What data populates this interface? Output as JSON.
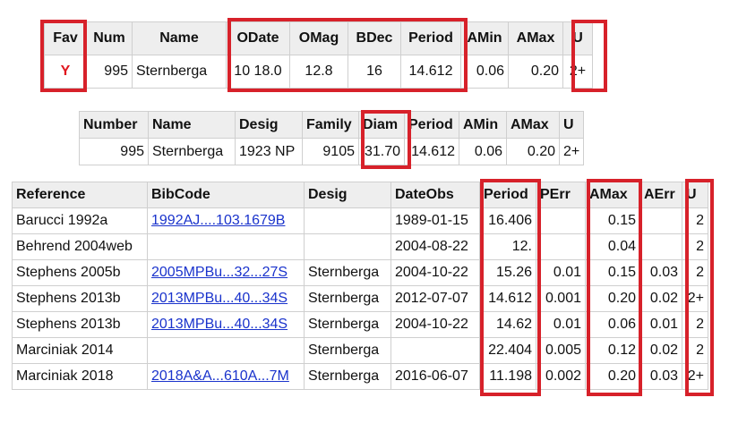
{
  "summary": {
    "headers": [
      "Fav",
      "Num",
      "Name",
      "ODate",
      "OMag",
      "BDec",
      "Period",
      "AMin",
      "AMax",
      "U"
    ],
    "row": {
      "fav": "Y",
      "num": "995",
      "name": "Sternberga",
      "odate": "10 18.0",
      "omag": "12.8",
      "bdec": "16",
      "period": "14.612",
      "amin": "0.06",
      "amax": "0.20",
      "u": "2+"
    }
  },
  "physical": {
    "headers": [
      "Number",
      "Name",
      "Desig",
      "Family",
      "Diam",
      "Period",
      "AMin",
      "AMax",
      "U"
    ],
    "row": {
      "number": "995",
      "name": "Sternberga",
      "desig": "1923 NP",
      "family": "9105",
      "diam": "31.70",
      "period": "14.612",
      "amin": "0.06",
      "amax": "0.20",
      "u": "2+"
    }
  },
  "references": {
    "headers": [
      "Reference",
      "BibCode",
      "Desig",
      "DateObs",
      "Period",
      "PErr",
      "AMax",
      "AErr",
      "U"
    ],
    "rows": [
      {
        "ref": "Barucci 1992a",
        "bib": "1992AJ....103.1679B",
        "desig": "",
        "date": "1989-01-15",
        "period": "16.406",
        "perr": "",
        "amax": "0.15",
        "aerr": "",
        "u": "2"
      },
      {
        "ref": "Behrend 2004web",
        "bib": "",
        "desig": "",
        "date": "2004-08-22",
        "period": "12.",
        "perr": "",
        "amax": "0.04",
        "aerr": "",
        "u": "2"
      },
      {
        "ref": "Stephens 2005b",
        "bib": "2005MPBu...32...27S",
        "desig": "Sternberga",
        "date": "2004-10-22",
        "period": "15.26",
        "perr": "0.01",
        "amax": "0.15",
        "aerr": "0.03",
        "u": "2"
      },
      {
        "ref": "Stephens 2013b",
        "bib": "2013MPBu...40...34S",
        "desig": "Sternberga",
        "date": "2012-07-07",
        "period": "14.612",
        "perr": "0.001",
        "amax": "0.20",
        "aerr": "0.02",
        "u": "2+"
      },
      {
        "ref": "Stephens 2013b",
        "bib": "2013MPBu...40...34S",
        "desig": "Sternberga",
        "date": "2004-10-22",
        "period": "14.62",
        "perr": "0.01",
        "amax": "0.06",
        "aerr": "0.01",
        "u": "2"
      },
      {
        "ref": "Marciniak 2014",
        "bib": "",
        "desig": "Sternberga",
        "date": "",
        "period": "22.404",
        "perr": "0.005",
        "amax": "0.12",
        "aerr": "0.02",
        "u": "2"
      },
      {
        "ref": "Marciniak 2018",
        "bib": "2018A&A...610A...7M",
        "desig": "Sternberga",
        "date": "2016-06-07",
        "period": "11.198",
        "perr": "0.002",
        "amax": "0.20",
        "aerr": "0.03",
        "u": "2+"
      }
    ]
  },
  "colors": {
    "highlight": "#d7212a",
    "fav": "#e0161e",
    "link": "#1a33cc",
    "header_bg": "#eeeeee"
  }
}
